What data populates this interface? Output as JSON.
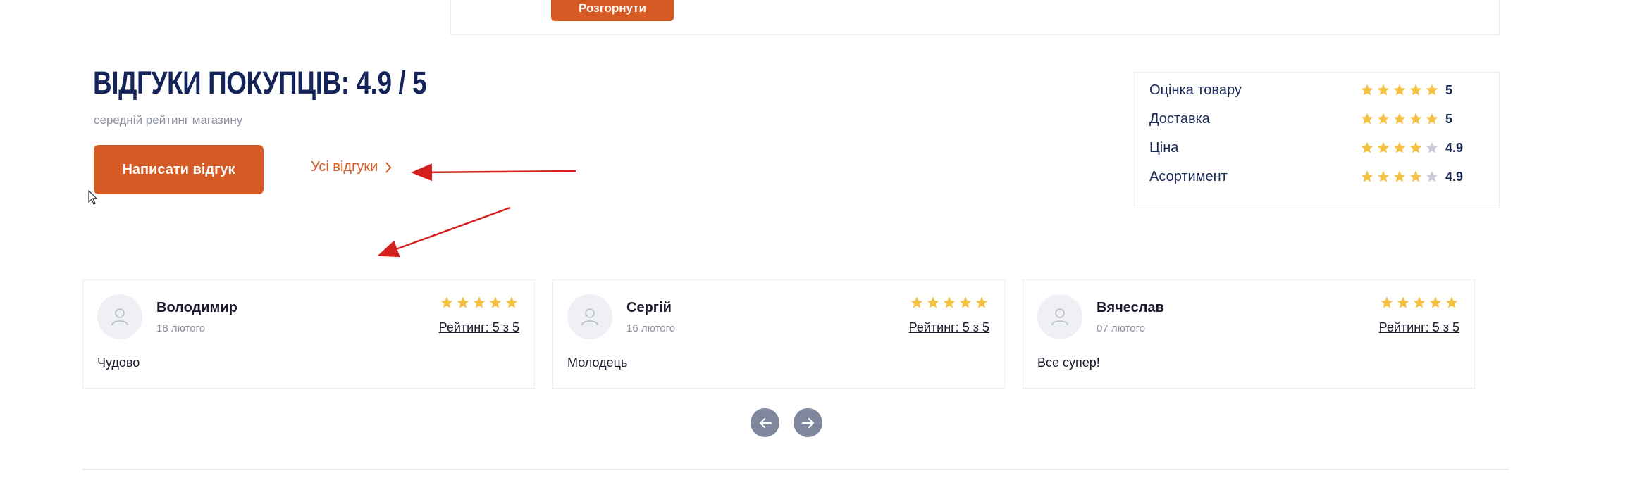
{
  "top": {
    "expand_label": "Розгорнути"
  },
  "reviews_header": {
    "title": "ВІДГУКИ ПОКУПЦІВ: 4.9 / 5",
    "subtitle": "середній рейтинг магазину",
    "write_button": "Написати відгук",
    "all_link": "Усі відгуки"
  },
  "rating_breakdown": [
    {
      "label": "Оцінка товару",
      "stars": 5,
      "value": "5"
    },
    {
      "label": "Доставка",
      "stars": 5,
      "value": "5"
    },
    {
      "label": "Ціна",
      "stars": 4,
      "value": "4.9"
    },
    {
      "label": "Асортимент",
      "stars": 4,
      "value": "4.9"
    }
  ],
  "reviews": [
    {
      "name": "Володимир",
      "date": "18 лютого",
      "stars": 5,
      "rating_text": "Рейтинг: 5 з 5",
      "text": "Чудово"
    },
    {
      "name": "Сергій",
      "date": "16 лютого",
      "stars": 5,
      "rating_text": "Рейтинг: 5 з 5",
      "text": "Молодець"
    },
    {
      "name": "Вячеслав",
      "date": "07 лютого",
      "stars": 5,
      "rating_text": "Рейтинг: 5 з 5",
      "text": "Все супер!"
    }
  ],
  "icons": {
    "star": "star-icon",
    "avatar": "user-avatar-icon",
    "prev": "arrow-left-icon",
    "next": "arrow-right-icon",
    "chevron": "chevron-right-icon"
  },
  "colors": {
    "accent": "#d65a23",
    "title": "#14245a",
    "star_filled": "#f5c142",
    "star_empty": "#c9cbd6",
    "nav_button": "#7f879d",
    "annotation_arrow": "#d41f1f"
  }
}
